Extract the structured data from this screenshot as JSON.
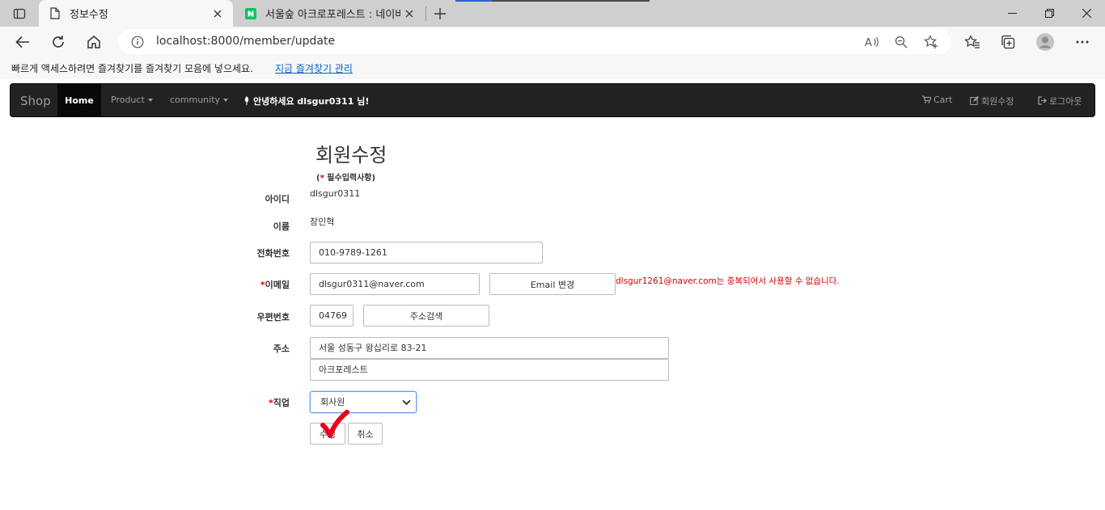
{
  "browser": {
    "tabs": [
      {
        "title": "정보수정",
        "active": true
      },
      {
        "title": "서울숲 아크로포레스트 : 네이버",
        "active": false
      }
    ],
    "address": {
      "url": "localhost:8000/member/update"
    },
    "favorites_bar": {
      "message": "빠르게 액세스하려면 즐겨찾기를 즐겨찾기 모음에 넣으세요.",
      "link": "지금 즐겨찾기 관리"
    }
  },
  "navbar": {
    "brand": "Shop",
    "home": "Home",
    "product": "Product",
    "community": "community",
    "greeting": "안녕하세요 dlsgur0311 님!",
    "cart": "Cart",
    "edit_member": "회원수정",
    "logout": "로그아웃"
  },
  "form": {
    "title": "회원수정",
    "required_note_star": "*",
    "required_note_text": " 필수입력사항)",
    "required_note_open": "(",
    "id_label": "아이디",
    "id_value": "dlsgur0311",
    "name_label": "이름",
    "name_value": "장인혁",
    "phone_label": "전화번호",
    "phone_value": "010-9789-1261",
    "email_star": "*",
    "email_label": "이메일",
    "email_value": "dlsgur0311@naver.com",
    "email_change_button": "Email 변경",
    "email_error": "dlsgur1261@naver.com는 중복되어서 사용할 수 없습니다.",
    "zip_label": "우편번호",
    "zip_value": "04769",
    "address_search_button": "주소검색",
    "address_label": "주소",
    "address1_value": "서울 성동구 왕십리로 83-21",
    "address2_value": "아크포레스트",
    "job_star": "*",
    "job_label": "직업",
    "job_selected": "회사원",
    "submit_button": "수정",
    "cancel_button": "취소"
  },
  "colors": {
    "navbar_bg": "#222222",
    "error": "#d10000",
    "link": "#0b62c4",
    "checkmark": "#e8001c"
  }
}
